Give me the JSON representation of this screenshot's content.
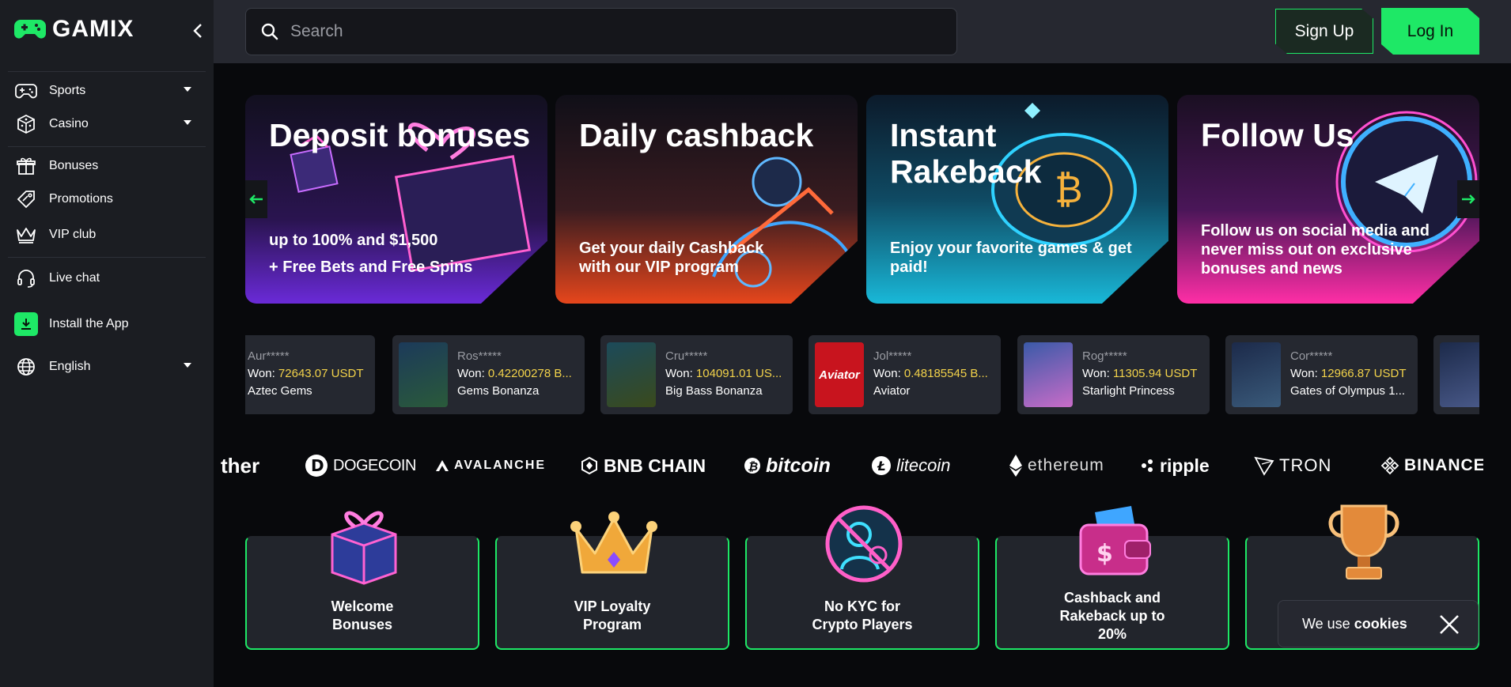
{
  "brand": {
    "name": "GAMIX",
    "accent": "#1ee866"
  },
  "sidebar": {
    "items": [
      {
        "label": "Sports",
        "icon": "gamepad-icon",
        "dropdown": true
      },
      {
        "label": "Casino",
        "icon": "dice-icon",
        "dropdown": true
      },
      {
        "label": "Bonuses",
        "icon": "gift-icon"
      },
      {
        "label": "Promotions",
        "icon": "tag-icon"
      },
      {
        "label": "VIP club",
        "icon": "crown-icon"
      },
      {
        "label": "Live chat",
        "icon": "headset-icon"
      },
      {
        "label": "Install the App",
        "icon": "download-icon"
      },
      {
        "label": "English",
        "icon": "globe-icon",
        "dropdown": true
      }
    ]
  },
  "header": {
    "search_placeholder": "Search",
    "signup_label": "Sign Up",
    "login_label": "Log In"
  },
  "banners": [
    {
      "title": "Deposit bonuses",
      "text_line1": "up to 100% and $1,500",
      "text_line2": "+ Free Bets and Free Spins"
    },
    {
      "title": "Daily cashback",
      "text_line1": "Get your daily Cashback",
      "text_line2": "with our VIP program"
    },
    {
      "title_line1": "Instant",
      "title_line2": "Rakeback",
      "text_line1": "Enjoy your favorite games & get",
      "text_line2": "paid!"
    },
    {
      "title": "Follow Us",
      "text_line1": "Follow us on social media and",
      "text_line2": "never miss out on exclusive",
      "text_line3": "bonuses and news"
    }
  ],
  "wins": [
    {
      "user": "Aur*****",
      "won_label": "Won:",
      "amount": "72643.07 USDT",
      "game": "Aztec Gems"
    },
    {
      "user": "Ros*****",
      "won_label": "Won:",
      "amount": "0.42200278 B...",
      "game": "Gems Bonanza"
    },
    {
      "user": "Cru*****",
      "won_label": "Won:",
      "amount": "104091.01 US...",
      "game": "Big Bass Bonanza"
    },
    {
      "user": "Jol*****",
      "won_label": "Won:",
      "amount": "0.48185545 B...",
      "game": "Aviator",
      "thumb_text": "Aviator"
    },
    {
      "user": "Rog*****",
      "won_label": "Won:",
      "amount": "11305.94 USDT",
      "game": "Starlight Princess"
    },
    {
      "user": "Cor*****",
      "won_label": "Won:",
      "amount": "12966.87 USDT",
      "game": "Gates of Olympus 1..."
    }
  ],
  "crypto": [
    "ther",
    "DOGECOIN",
    "AVALANCHE",
    "BNB CHAIN",
    "bitcoin",
    "litecoin",
    "ethereum",
    "ripple",
    "TRON",
    "BINANCE"
  ],
  "features": [
    {
      "line1": "Welcome",
      "line2": "Bonuses"
    },
    {
      "line1": "VIP Loyalty",
      "line2": "Program"
    },
    {
      "line1": "No KYC for",
      "line2": "Crypto Players"
    },
    {
      "line1": "Cashback and",
      "line2": "Rakeback up to",
      "line3": "20%"
    },
    {
      "line1": ""
    }
  ],
  "cookie": {
    "text": "We use",
    "bold": "cookies"
  }
}
